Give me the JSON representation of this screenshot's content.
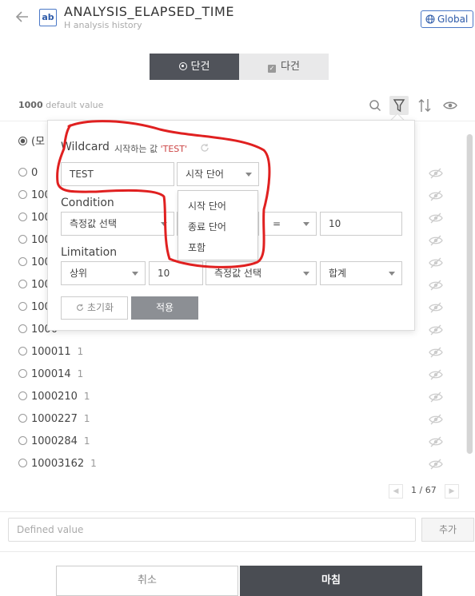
{
  "header": {
    "back_icon": "arrow-left-icon",
    "badge": "ab",
    "title": "ANALYSIS_ELAPSED_TIME",
    "subtitle": "H analysis history",
    "global_label": "Global"
  },
  "mode_tabs": {
    "single": "단건",
    "multi": "다건"
  },
  "list_summary": {
    "count": "1000",
    "count_label": "default value"
  },
  "toolbar_icons": [
    "search-icon",
    "filter-icon",
    "sort-icon",
    "eye-icon"
  ],
  "list": {
    "select_all_label": "(모",
    "rows": [
      {
        "value": "0",
        "count": ""
      },
      {
        "value": "100",
        "count": ""
      },
      {
        "value": "100",
        "count": ""
      },
      {
        "value": "100",
        "count": ""
      },
      {
        "value": "100",
        "count": ""
      },
      {
        "value": "100",
        "count": ""
      },
      {
        "value": "100",
        "count": ""
      },
      {
        "value": "1000",
        "count": ""
      },
      {
        "value": "100011",
        "count": "1"
      },
      {
        "value": "100014",
        "count": "1"
      },
      {
        "value": "1000210",
        "count": "1"
      },
      {
        "value": "1000227",
        "count": "1"
      },
      {
        "value": "1000284",
        "count": "1"
      },
      {
        "value": "10003162",
        "count": "1"
      }
    ]
  },
  "pagination": {
    "text": "1 / 67"
  },
  "defined_value": {
    "placeholder": "Defined value",
    "add_label": "추가"
  },
  "footer": {
    "cancel": "취소",
    "done": "마침"
  },
  "filter_popup": {
    "wildcard": {
      "label": "Wildcard",
      "hint_prefix": "시작하는 값",
      "hint_value": "'TEST'",
      "input_value": "TEST",
      "mode_selected": "시작 단어",
      "mode_options": [
        "시작 단어",
        "종료 단어",
        "포함"
      ]
    },
    "condition": {
      "label": "Condition",
      "measure_selected": "측정값 선택",
      "operator": "=",
      "value": "10"
    },
    "limitation": {
      "label": "Limitation",
      "rank_selected": "상위",
      "count": "10",
      "measure_selected": "측정값 선택",
      "agg_selected": "합계"
    },
    "reset_label": "초기화",
    "apply_label": "적용"
  },
  "colors": {
    "accent_blue": "#2d5aa8",
    "dark_button": "#4a4d53",
    "annotation_red": "#e02020",
    "hint_value": "#cc4444"
  }
}
